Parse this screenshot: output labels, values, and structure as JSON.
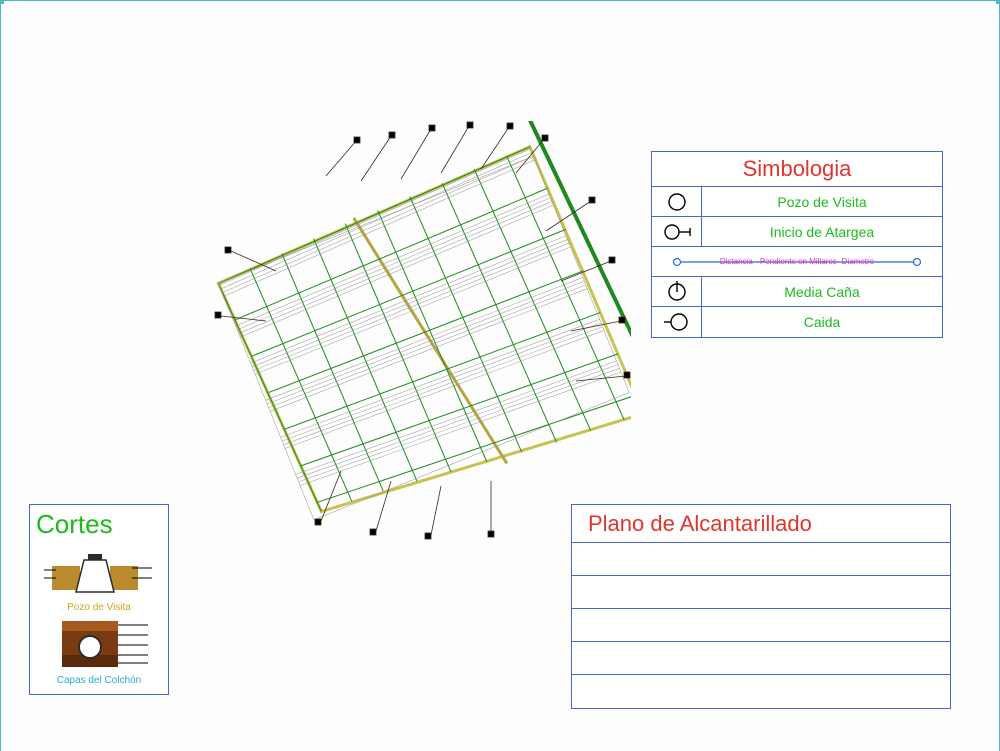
{
  "simbologia": {
    "title": "Simbologia",
    "rows": [
      {
        "label": "Pozo de Visita"
      },
      {
        "label": "Inicio de Atargea"
      },
      {
        "label": "Media Caña"
      },
      {
        "label": "Caida"
      }
    ],
    "line_label": "Distancia - Pendiente en Millares- Diametro"
  },
  "titleblock": {
    "title": "Plano de Alcantarillado"
  },
  "cortes": {
    "title": "Cortes",
    "item1": "Pozo de Visita",
    "item2": "Capas del Colchón"
  }
}
